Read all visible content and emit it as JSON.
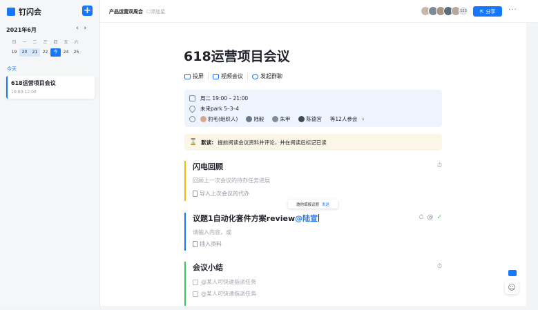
{
  "app": {
    "name": "钉闪会",
    "brand_color": "#1677ff"
  },
  "calendar": {
    "month": "2021年6月",
    "weekdays": [
      "日",
      "一",
      "二",
      "三",
      "四",
      "五",
      "六"
    ],
    "days": [
      "19",
      "20",
      "21",
      "22",
      "今",
      "24",
      "25"
    ],
    "today_label": "今天"
  },
  "sidebar_meeting": {
    "title": "618运营项目会议",
    "time": "10:00-12:00"
  },
  "topbar": {
    "doc_name": "产品运营双周会",
    "add_label": "添加星",
    "participant_count": "123",
    "share_label": "分享",
    "more_label": "···"
  },
  "meeting": {
    "title": "618运营项目会议",
    "actions": [
      "投屏",
      "视频会议",
      "发起群聊"
    ],
    "time": "周二 19:00 – 21:00",
    "location": "未来park 5–3–4",
    "participants": [
      "豹毛(组织人)",
      "陆毅",
      "朱甲",
      "陈德宫"
    ],
    "participants_more": "等12人参会",
    "notice_key": "默读:",
    "notice_text": "提前阅读会议资料并评论，并在阅读后标记已读"
  },
  "sections": {
    "flash": {
      "title": "闪电回顾",
      "desc": "回顾上一次会议的待办任务进展",
      "link": "导入上次会议的代办"
    },
    "topic": {
      "title": "议题1自动化套件方案review",
      "mention": "@陆宣",
      "placeholder": "请输入内容，或",
      "link": "插入资料"
    },
    "summary": {
      "title": "会议小结",
      "items": [
        "@某人可快速指派任务",
        "@某人可快速指派任务"
      ]
    }
  },
  "tooltip": {
    "text": "邀他填报议题",
    "send": "发送"
  }
}
